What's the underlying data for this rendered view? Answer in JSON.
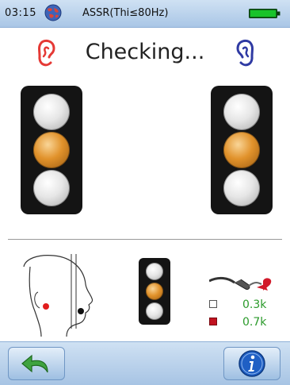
{
  "status_bar": {
    "time": "03:15",
    "mode": "ASSR(Thi≤80Hz)",
    "globe_icon": "globe-icon",
    "battery_icon": "battery-full-icon",
    "battery_level": 1.0
  },
  "header": {
    "title": "Checking...",
    "left_ear_icon": "right-ear-red-icon",
    "right_ear_icon": "left-ear-blue-icon",
    "left_ear_color": "#e53935",
    "right_ear_color": "#2f3aa3"
  },
  "lights": {
    "left": [
      "off",
      "on",
      "off"
    ],
    "right": [
      "off",
      "on",
      "off"
    ],
    "small": [
      "off",
      "on",
      "off"
    ],
    "on_color": "#e1922b",
    "off_color": "#e6e6e6"
  },
  "impedance": {
    "electrode_icon": "electrode-icon",
    "rows": [
      {
        "swatch": "white",
        "value": "0.3k"
      },
      {
        "swatch": "red",
        "value": "0.7k"
      }
    ],
    "value_color": "#2b9a2b"
  },
  "toolbar": {
    "back_icon": "back-arrow-icon",
    "info_icon": "info-icon"
  }
}
